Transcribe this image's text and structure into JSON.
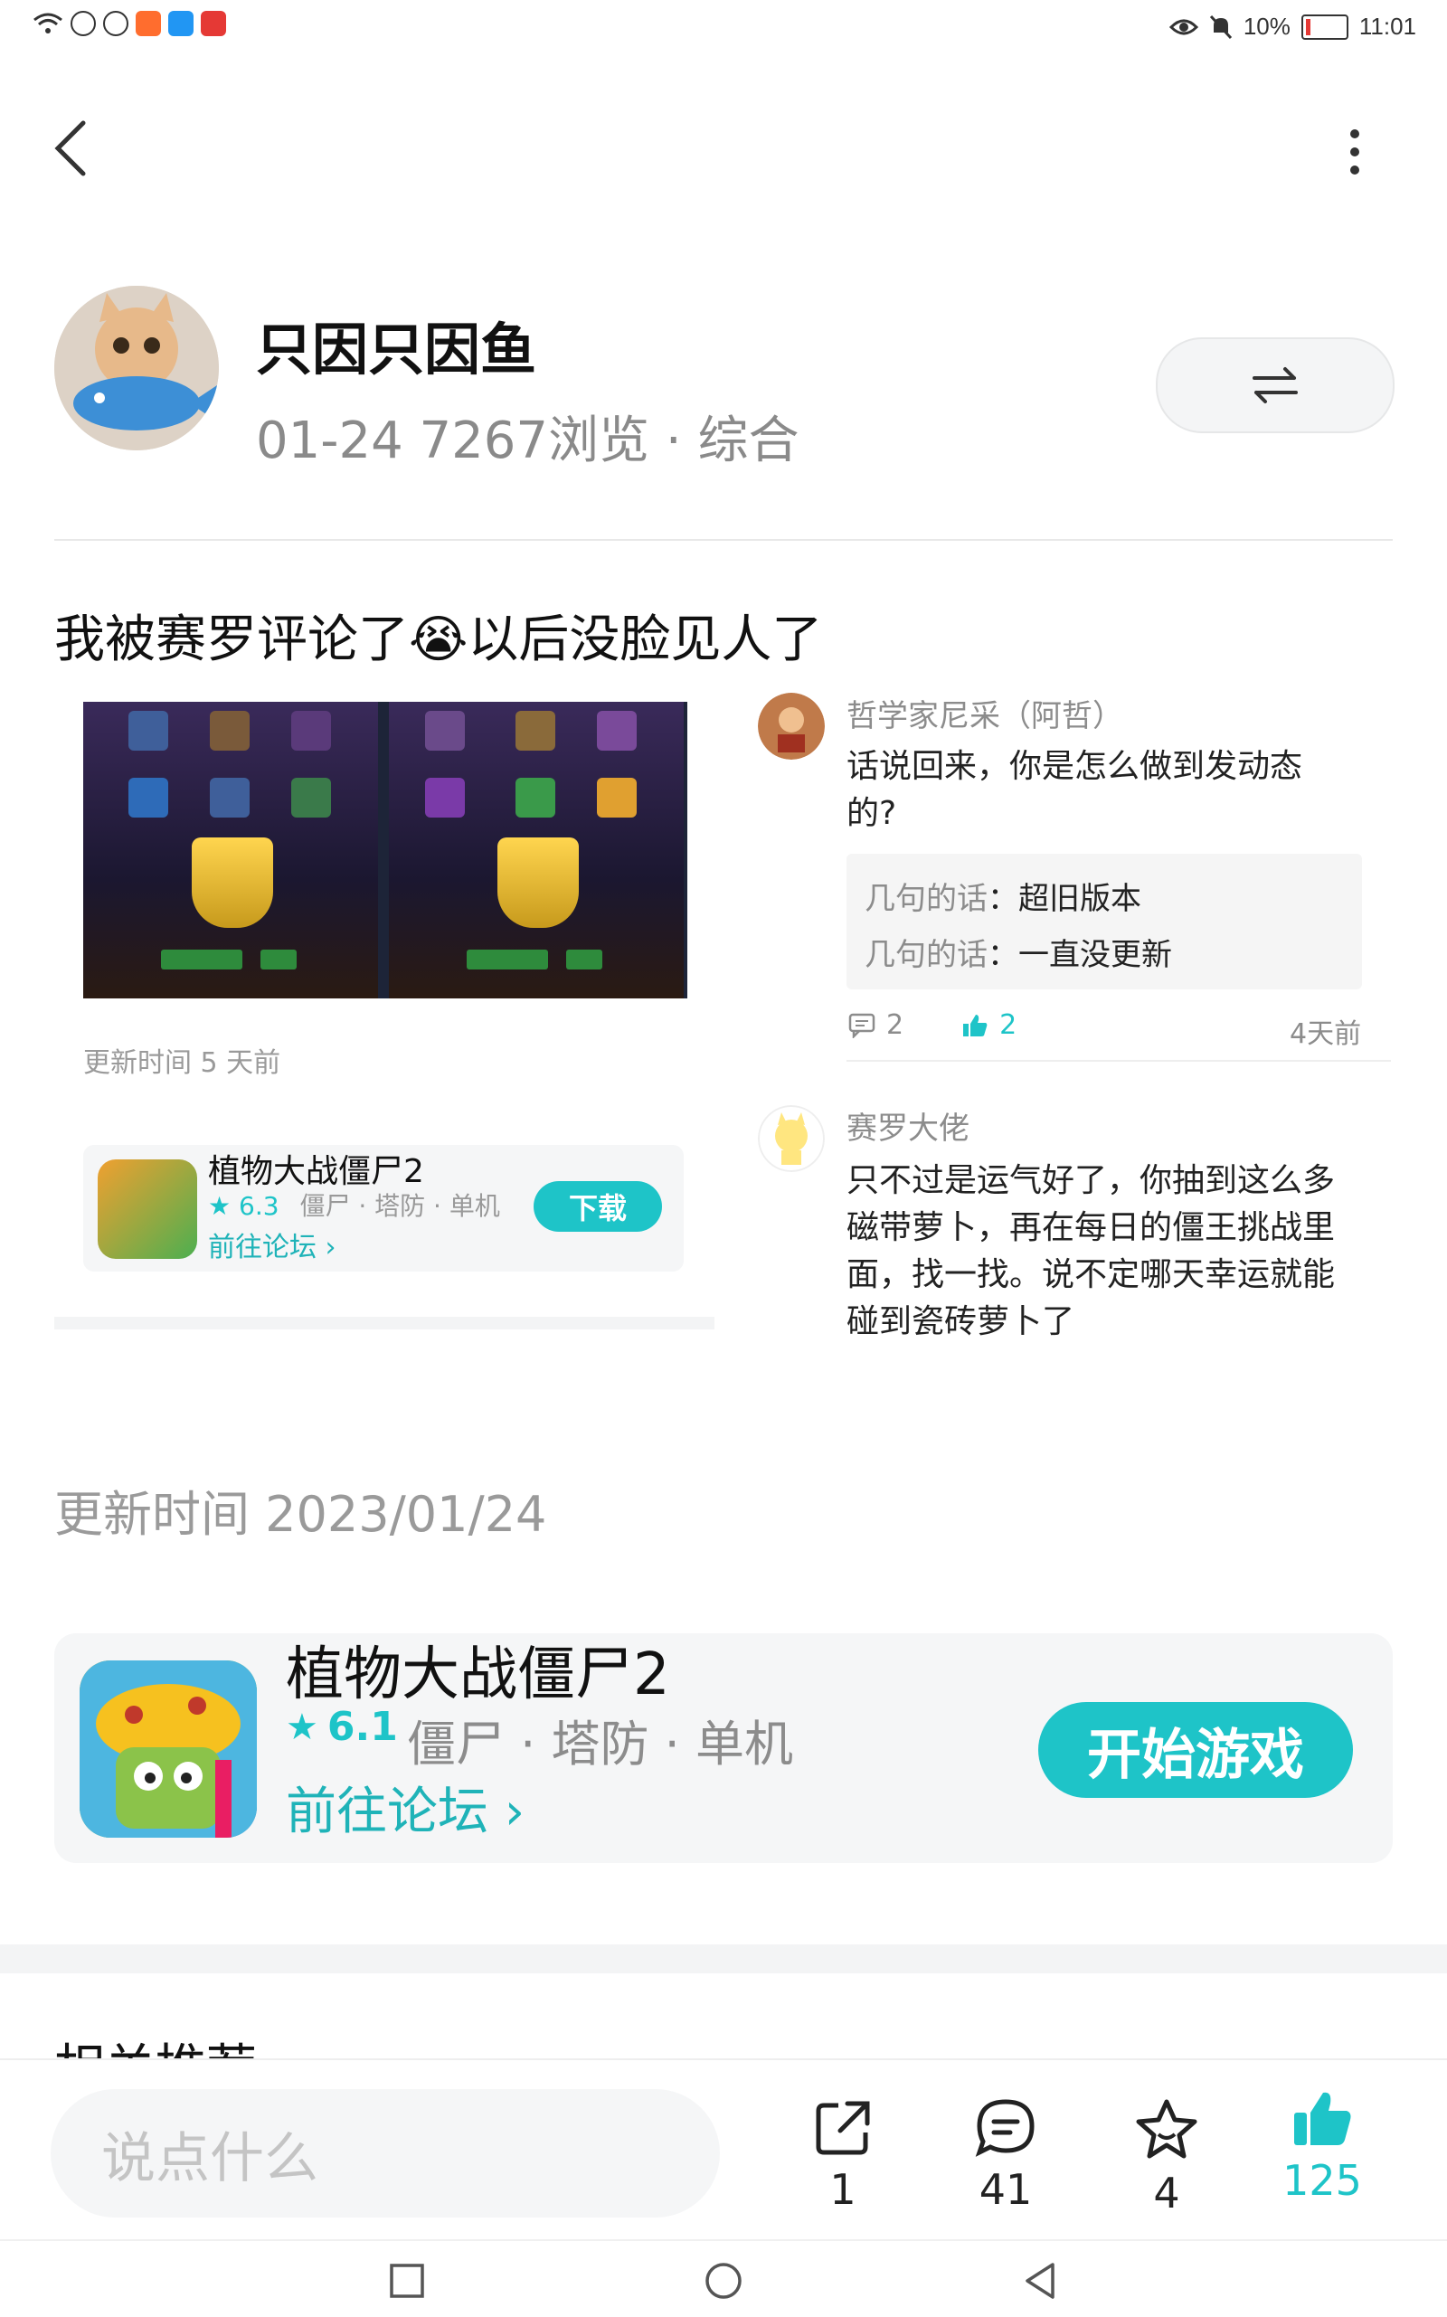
{
  "status_bar": {
    "battery": "10%",
    "time": "11:01"
  },
  "author": {
    "name": "只因只因鱼",
    "meta": "01-24 7267浏览 · 综合"
  },
  "post": {
    "title": "我被赛罗评论了😭以后没脸见人了",
    "image_update": "更新时间 5 天前"
  },
  "mini_game": {
    "name": "植物大战僵尸2",
    "rating": "6.3",
    "tags": "僵尸 · 塔防 · 单机",
    "forum": "前往论坛 ›",
    "download": "下载"
  },
  "comments": [
    {
      "name": "哲学家尼采（阿哲）",
      "text_lines": [
        "话说回来，你是怎么做到发动态",
        "的?"
      ],
      "replies": [
        {
          "name": "几句的话",
          "sep": "：",
          "text": "超旧版本"
        },
        {
          "name": "几句的话",
          "sep": "：",
          "text": "一直没更新"
        }
      ],
      "reply_count": "2",
      "like_count": "2",
      "time": "4天前"
    },
    {
      "name": "赛罗大佬",
      "text_lines": [
        "只不过是运气好了，你抽到这么多",
        "磁带萝卜，再在每日的僵王挑战里",
        "面，找一找。说不定哪天幸运就能",
        "碰到瓷砖萝卜了"
      ]
    }
  ],
  "update_time": "更新时间 2023/01/24",
  "game": {
    "name": "植物大战僵尸2",
    "rating": "6.1",
    "tags": "僵尸 · 塔防 · 单机",
    "forum": "前往论坛 ›",
    "play": "开始游戏"
  },
  "related_title": "相关推荐",
  "action_bar": {
    "input_placeholder": "说点什么",
    "share_count": "1",
    "comment_count": "41",
    "favorite_count": "4",
    "like_count": "125"
  },
  "colors": {
    "accent": "#1ec4c8",
    "text_muted": "#8c8c8c"
  }
}
